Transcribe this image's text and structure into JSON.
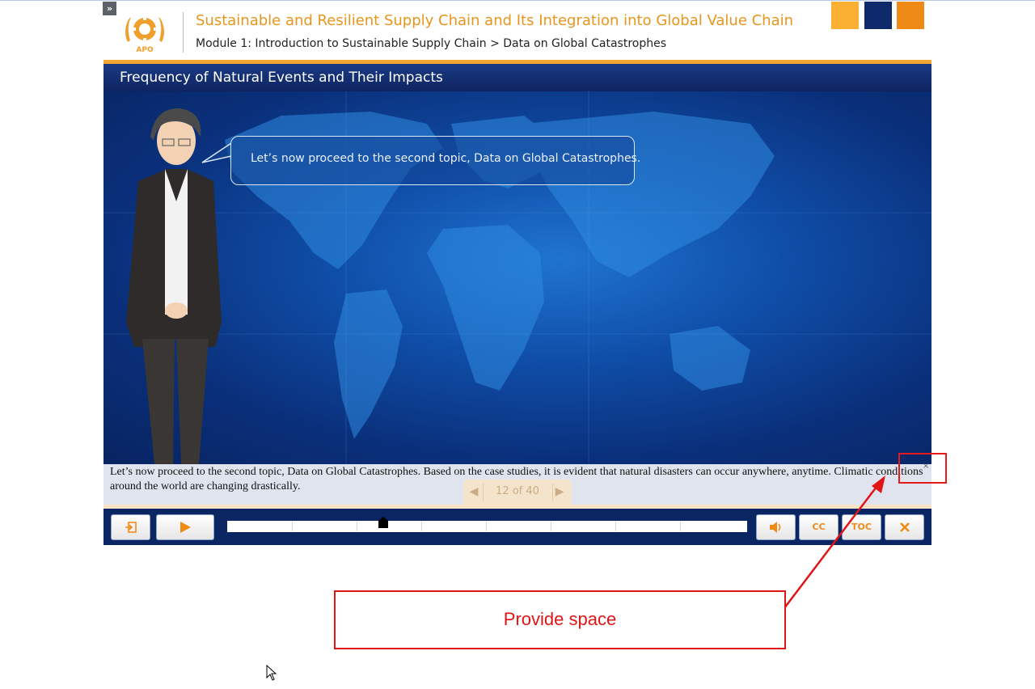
{
  "header": {
    "course_title": "Sustainable and Resilient Supply Chain and Its Integration into Global Value Chain",
    "breadcrumb": "Module 1: Introduction to Sustainable Supply Chain > Data on Global Catastrophes",
    "logo_text": "APO",
    "expand_icon": "»"
  },
  "colors": {
    "accent_orange": "#e8951c",
    "navy": "#0b2562",
    "square_1": "#fbb034",
    "square_2": "#0f2a6b",
    "square_3": "#ef8a16",
    "annotation_red": "#e01515"
  },
  "slide": {
    "title": "Frequency of Natural Events and Their Impacts",
    "speech_bubble": "Let’s now proceed to the second topic, Data on Global Catastrophes."
  },
  "caption": {
    "text": "Let’s now proceed to the second topic, Data on Global Catastrophes. Based on the case studies, it is evident that natural disasters can occur anywhere, anytime. Climatic conditions around the world are changing drastically.",
    "close_icon": "×"
  },
  "pager": {
    "text": "12 of 40",
    "prev_icon": "◀",
    "next_icon": "▶"
  },
  "controls": {
    "exit_icon": "exit-icon",
    "play_icon": "play-icon",
    "volume_icon": "volume-icon",
    "cc_label": "CC",
    "toc_label": "TOC",
    "close_icon": "close-icon",
    "progress": 0.3
  },
  "annotation": {
    "label": "Provide space"
  }
}
